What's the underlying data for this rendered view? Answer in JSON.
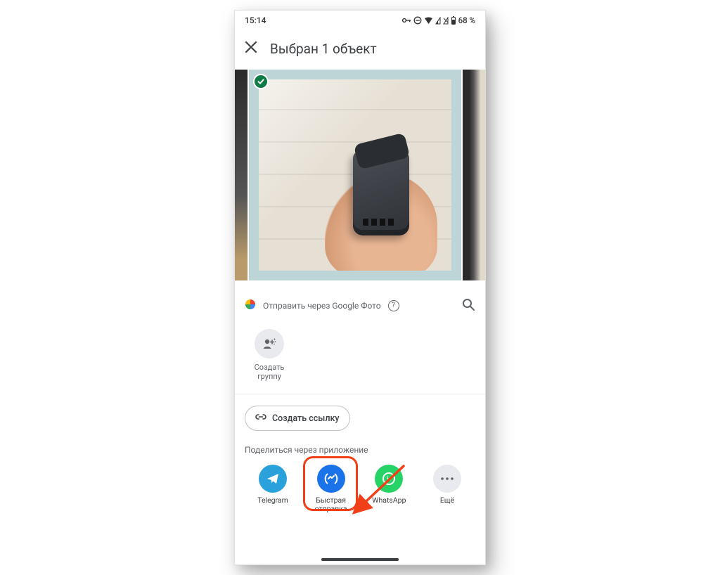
{
  "status": {
    "time": "15:14",
    "battery_text": "68 %"
  },
  "header": {
    "title": "Выбран 1 объект"
  },
  "share": {
    "gphotos_label": "Отправить через Google Фото",
    "create_group_label": "Создать\nгруппу",
    "create_link_label": "Создать ссылку",
    "section_label": "Поделиться через приложение"
  },
  "apps": {
    "telegram": "Telegram",
    "nearby": "Быстрая\nотправка",
    "whatsapp": "WhatsApp",
    "more": "Ещё"
  },
  "colors": {
    "highlight": "#f13f18",
    "nearby_blue": "#1a73e8",
    "telegram_blue": "#2aa1da",
    "whatsapp_green": "#25d366",
    "check_green": "#0f7b47"
  }
}
